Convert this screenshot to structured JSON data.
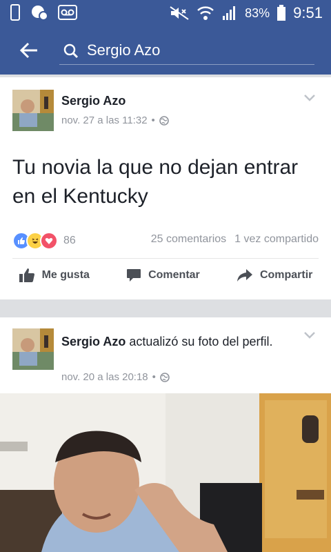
{
  "status_bar": {
    "battery": "83%",
    "time": "9:51",
    "icons": [
      "phone-outline-icon",
      "chat-badge-icon",
      "voicemail-icon",
      "mute-icon",
      "wifi-icon",
      "signal-icon",
      "battery-icon"
    ],
    "battery_level": 0.83
  },
  "search": {
    "query": "Sergio Azo"
  },
  "post1": {
    "author": "Sergio Azo",
    "timestamp": "nov. 27 a las 11:32",
    "separator": "•",
    "text": "Tu novia la que no dejan entrar en el Kentucky",
    "reaction_count": "86",
    "comments": "25 comentarios",
    "shares": "1 vez compartido",
    "actions": {
      "like": "Me gusta",
      "comment": "Comentar",
      "share": "Compartir"
    }
  },
  "post2": {
    "author": "Sergio Azo",
    "action_text": "actualizó su foto del perfil.",
    "timestamp": "nov. 20 a las 20:18",
    "separator": "•"
  },
  "colors": {
    "brand": "#3b5998",
    "like_blue": "#5890ff",
    "love_red": "#f25268",
    "haha_yellow": "#fcd146",
    "meta_gray": "#90949c"
  }
}
